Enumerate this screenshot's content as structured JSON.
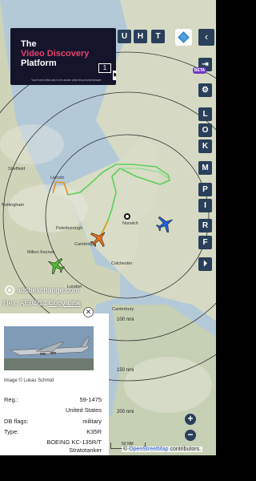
{
  "ad": {
    "line1": "The",
    "line2": "Video Discovery",
    "line3": "Platform",
    "subtext": "You'll need (this ad) to be aware only this provider/player",
    "count": "1",
    "skip_icon": "skip-next-icon"
  },
  "top_buttons": [
    "U",
    "H",
    "T"
  ],
  "right_buttons": [
    "L",
    "O",
    "K",
    "M",
    "P",
    "I",
    "R",
    "F"
  ],
  "beta_label": "BETA",
  "map": {
    "cities": [
      {
        "name": "Lincoln"
      },
      {
        "name": "Peterborough"
      },
      {
        "name": "Cambridge"
      },
      {
        "name": "Norwich"
      },
      {
        "name": "Colchester"
      },
      {
        "name": "Milton Keynes"
      },
      {
        "name": "London"
      },
      {
        "name": "Canterbury"
      },
      {
        "name": "Sheffield"
      },
      {
        "name": "Nottingham"
      }
    ],
    "ring_labels": [
      "100 nmi",
      "150 nmi",
      "200 nmi"
    ],
    "scale_label": "50 NM"
  },
  "attribution": {
    "logo_text": "adsbexchange.com",
    "osm_prefix": "©",
    "osm_link": "OpenStreetMap",
    "osm_suffix": "contributors."
  },
  "selected": {
    "hex_label": "Hex:",
    "hex_value": "AE04C4",
    "copy_link": "Copy Link",
    "photo_credit": "Image © Lukas Schmid",
    "rows": [
      {
        "label": "Reg.:",
        "value": "59-1475"
      },
      {
        "label": "",
        "value": "United States"
      },
      {
        "label": "DB flags:",
        "value": "military"
      },
      {
        "label": "Type:",
        "value": "K35R"
      },
      {
        "label": "",
        "value": "BOEING KC-135R/T"
      },
      {
        "label": "",
        "value": "Stratotanker"
      }
    ]
  },
  "zoom": {
    "in": "+",
    "out": "−"
  },
  "colors": {
    "button_bg": "#2a3f5a",
    "plane_orange": "#f07020",
    "plane_green": "#50c030",
    "plane_blue": "#2060e0",
    "track_green": "#5cd05c",
    "track_orange": "#f09030"
  }
}
